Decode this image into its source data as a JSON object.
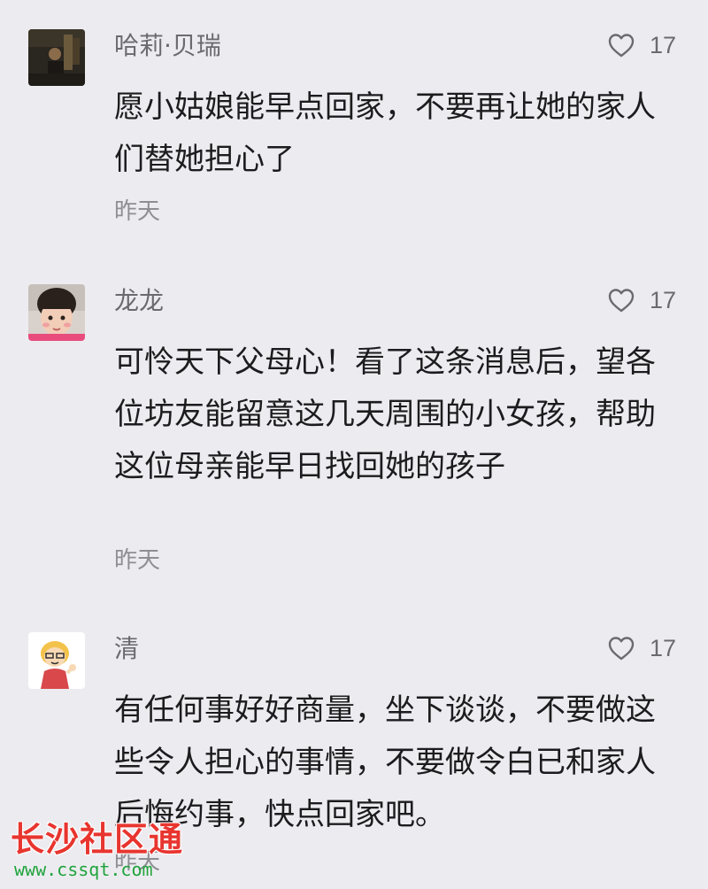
{
  "comments": [
    {
      "user": "哈莉·贝瑞",
      "likes": "17",
      "text": "愿小姑娘能早点回家，不要再让她的家人们替她担心了",
      "time": "昨天",
      "avatar": "dark-photo-avatar"
    },
    {
      "user": "龙龙",
      "likes": "17",
      "text": "可怜天下父母心！看了这条消息后，望各位坊友能留意这几天周围的小女孩，帮助这位母亲能早日找回她的孩子",
      "time": "昨天",
      "avatar": "child-photo-avatar"
    },
    {
      "user": "清",
      "likes": "17",
      "text": "有任何事好好商量，坐下谈谈，不要做这些令人担心的事情，不要做令白已和家人后悔约事，快点回家吧。",
      "time": "昨天",
      "avatar": "cartoon-avatar"
    }
  ],
  "icons": {
    "like": "heart-outline-icon"
  },
  "watermark": {
    "title": "长沙社区通",
    "url": "www.cssqt.com"
  },
  "colors": {
    "background": "#ececf0",
    "text": "#1c1c1e",
    "meta": "#6a6a6f",
    "watermark_red": "#e8352f",
    "watermark_green": "#21a33c"
  }
}
